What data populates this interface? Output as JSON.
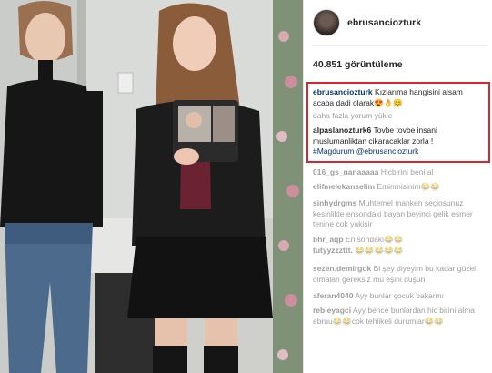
{
  "post": {
    "username": "ebrusanciozturk",
    "views": "40.851 görüntüleme",
    "caption_user": "ebrusanciozturk",
    "caption_text": "Kızlarıma hangisini alsam acaba dadi olarak😍👌😊",
    "load_more": "daha fazla yorum yükle"
  },
  "highlight_comment": {
    "user": "alpaslanozturk6",
    "text": "Tovbe tovbe insani muslumanliktan cikaracaklar zorla !",
    "tags": "#Magdurum @ebrusanciozturk"
  },
  "comments": [
    {
      "user": "016_gs_nanaaaaa",
      "text": "Hicbirini beni al"
    },
    {
      "user": "elifmelekanselim",
      "text": "Eminmisinim😂😂"
    },
    {
      "user": "sinhydrgms",
      "text": "Muhtemel manken seçiosunuz kesinlikle ensondaki bayan beyinci gelik esmer tenine cok yakisir"
    },
    {
      "user": "bhr_aqp",
      "text": "En sondaki😂😂"
    },
    {
      "user": "tutyyzzzttt.",
      "text": "😂😂😂😂😂"
    },
    {
      "user": "sezen.demirgok",
      "text": "Bi şey diyeyim bu kadar güzel olmalari gereksiz mu eşini düşün"
    },
    {
      "user": "aferan4040",
      "text": "Ayy bunlar çocuk bakarmı"
    },
    {
      "user": "rebleyagci",
      "text": "Ayy bence bunlardan hic birini alma ebruu😂😂cok tehlikeli durumlar😂😂"
    }
  ],
  "colors": {
    "highlight": "#d7262e",
    "accent": "#003569"
  },
  "icons": {
    "avatar": "profile-avatar"
  }
}
